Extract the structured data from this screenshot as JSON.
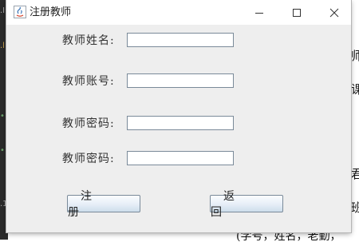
{
  "window": {
    "title": "注册教师"
  },
  "form": {
    "name_label": "教师姓名:",
    "account_label": "教师账号:",
    "password_label": "教师密码:",
    "confirm_password_label": "教师密码:",
    "name_value": "",
    "account_value": "",
    "password_value": "",
    "confirm_password_value": ""
  },
  "buttons": {
    "register": "注 册",
    "back": "返 回"
  },
  "background": {
    "right_fragments": [
      "师",
      "课",
      "君",
      "班"
    ],
    "bottom_text": "(学号，姓名，老勤，"
  }
}
